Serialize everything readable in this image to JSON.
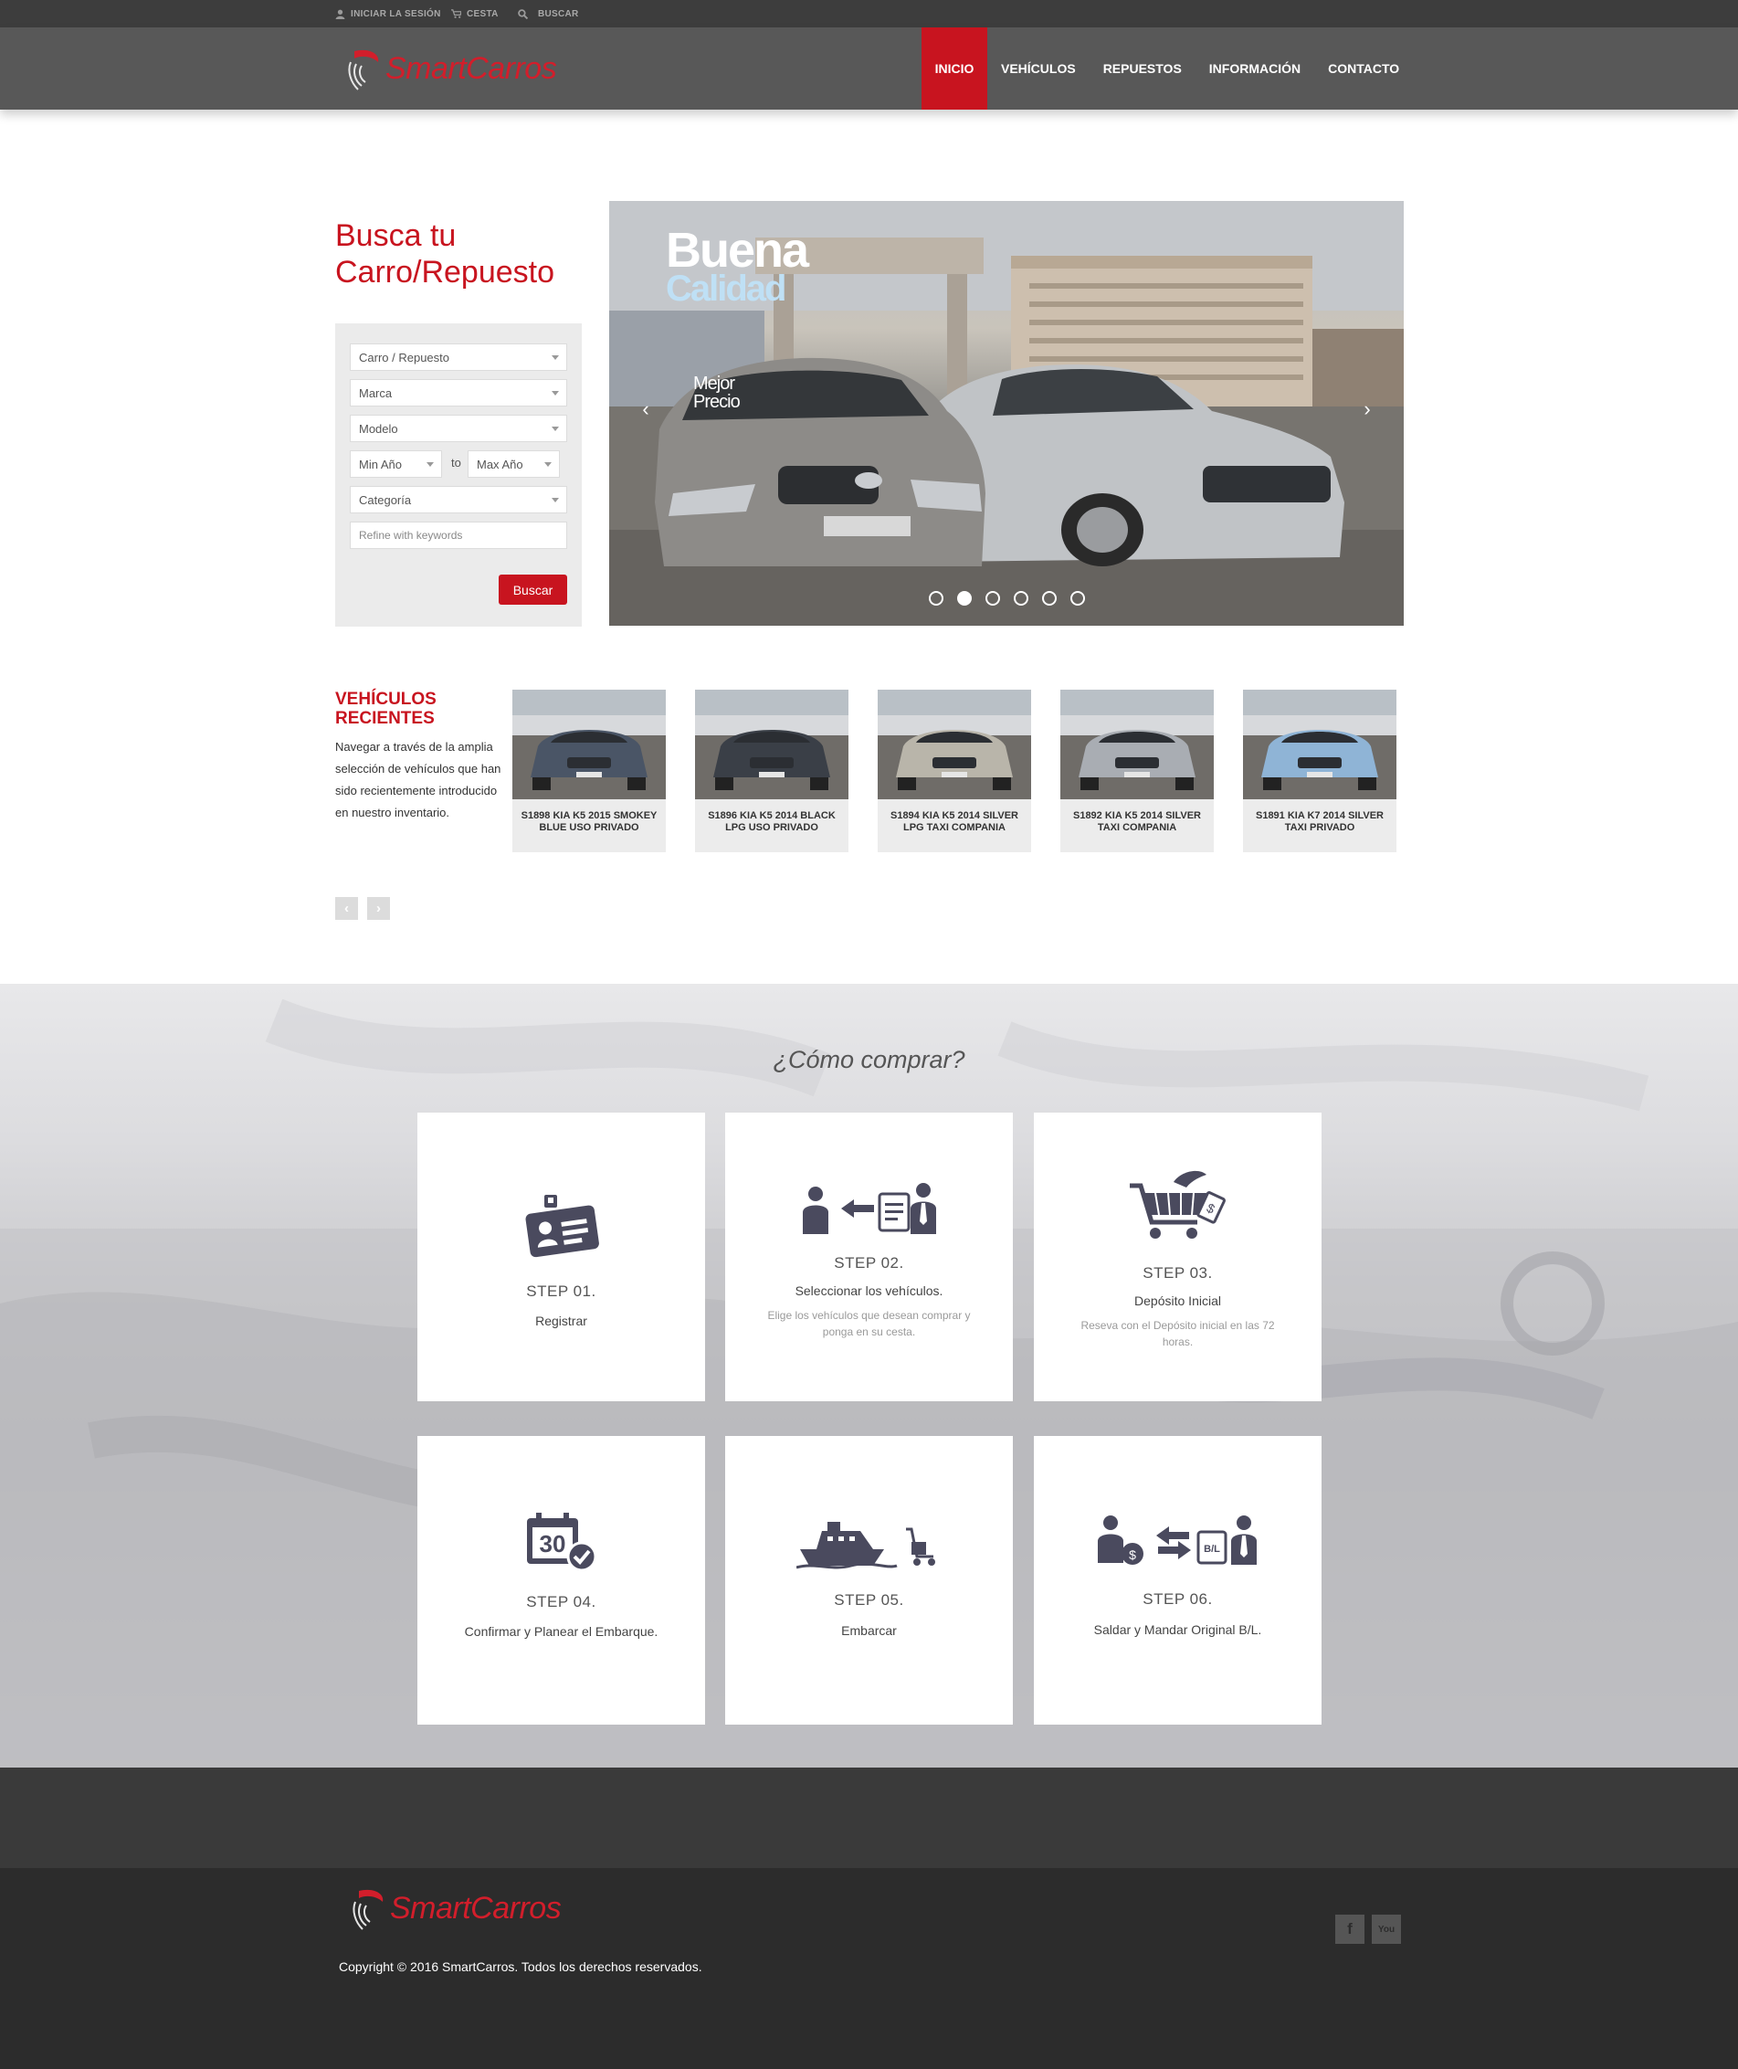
{
  "topbar": {
    "login": "INICIAR LA SESIÓN",
    "cart": "CESTA",
    "search": "BUSCAR"
  },
  "brand": {
    "name": "SmartCarros",
    "color": "#d21e2b"
  },
  "nav": [
    {
      "label": "INICIO",
      "active": true
    },
    {
      "label": "VEHÍCULOS",
      "active": false
    },
    {
      "label": "REPUESTOS",
      "active": false
    },
    {
      "label": "INFORMACIÓN",
      "active": false
    },
    {
      "label": "CONTACTO",
      "active": false
    }
  ],
  "search": {
    "title": "Busca tu Carro/Repuesto",
    "type_select": "Carro / Repuesto",
    "make_select": "Marca",
    "model_select": "Modelo",
    "min_year": "Min Año",
    "to": "to",
    "max_year": "Max Año",
    "category_select": "Categoría",
    "keywords_placeholder": "Refine with keywords",
    "submit": "Buscar"
  },
  "slider": {
    "headline": "Buena",
    "subheadline": "Calidad",
    "caption_line1": "Mejor",
    "caption_line2": "Precio",
    "slide_count": 6,
    "active_slide": 2
  },
  "recent": {
    "title": "VEHÍCULOS RECIENTES",
    "description": "Navegar a través de la amplia selección de vehículos que han sido recientemente introducido en nuestro inventario.",
    "cars": [
      {
        "caption": "S1898 KIA K5 2015 SMOKEY BLUE USO PRIVADO",
        "color": "#4a5566"
      },
      {
        "caption": "S1896 KIA K5 2014 BLACK LPG USO PRIVADO",
        "color": "#3a3f47"
      },
      {
        "caption": "S1894 KIA K5 2014 SILVER LPG TAXI COMPANIA",
        "color": "#b9b5aa"
      },
      {
        "caption": "S1892 KIA K5 2014 SILVER TAXI COMPANIA",
        "color": "#a9adb3"
      },
      {
        "caption": "S1891 KIA K7 2014 SILVER TAXI PRIVADO",
        "color": "#8fb4d6"
      }
    ]
  },
  "howto": {
    "title": "¿Cómo comprar?",
    "steps": [
      {
        "title": "STEP 01.",
        "subtitle": "Registrar",
        "note": "",
        "icon": "id-card-icon"
      },
      {
        "title": "STEP 02.",
        "subtitle": "Seleccionar los vehículos.",
        "note": "Elige los vehículos que desean comprar y ponga en su cesta.",
        "icon": "select-vehicle-icon"
      },
      {
        "title": "STEP 03.",
        "subtitle": "Depósito Inicial",
        "note": "Reseva con el Depósito inicial en las 72 horas.",
        "icon": "cart-deposit-icon"
      },
      {
        "title": "STEP 04.",
        "subtitle": "Confirmar y Planear el Embarque.",
        "note": "",
        "icon": "calendar-check-icon"
      },
      {
        "title": "STEP 05.",
        "subtitle": "Embarcar",
        "note": "",
        "icon": "ship-icon"
      },
      {
        "title": "STEP 06.",
        "subtitle": "Saldar y Mandar Original B/L.",
        "note": "",
        "icon": "exchange-bl-icon"
      }
    ]
  },
  "calendar_number": "30",
  "bl_label": "B/L",
  "footer": {
    "copyright": "Copyright © 2016 SmartCarros. Todos los derechos reservados.",
    "facebook": "f",
    "youtube": "You"
  }
}
